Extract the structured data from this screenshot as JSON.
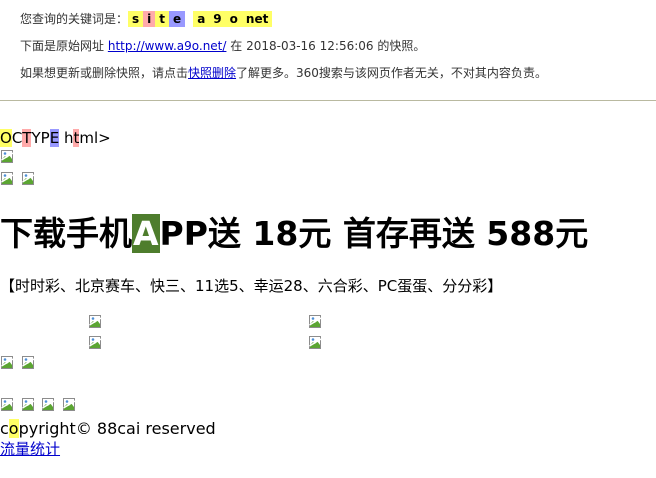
{
  "header": {
    "query_prefix": "您查询的关键词是：",
    "keywords": [
      {
        "text": "s",
        "color": "#ffff66"
      },
      {
        "text": "i",
        "color": "#ffaaaa"
      },
      {
        "text": "t",
        "color": "#ffff66"
      },
      {
        "text": "e",
        "color": "#9999ff"
      },
      {
        "text": "a",
        "color": "#ffff66"
      },
      {
        "text": "9",
        "color": "#ffff66"
      },
      {
        "text": "o",
        "color": "#ffff66"
      },
      {
        "text": "net",
        "color": "#ffff66"
      }
    ],
    "original_prefix": "下面是原始网址",
    "original_url": "http://www.a9o.net/",
    "snapshot_date_text": "在 2018-03-16 12:56:06 的快照。",
    "notice_prefix": "如果想更新或删除快照，请点击",
    "notice_link": "快照删除",
    "notice_suffix": "了解更多。360搜索与该网页作者无关，不对其内容负责。"
  },
  "page": {
    "doctype_parts": [
      {
        "text": "O",
        "color": "#ffff66"
      },
      {
        "text": "C",
        "color": ""
      },
      {
        "text": "T",
        "color": "#ffaaaa"
      },
      {
        "text": "Y",
        "color": ""
      },
      {
        "text": "P",
        "color": ""
      },
      {
        "text": "E",
        "color": "#9999ff"
      },
      {
        "text": " h",
        "color": ""
      },
      {
        "text": "t",
        "color": "#ffaaaa"
      },
      {
        "text": "ml>",
        "color": ""
      }
    ],
    "title_before": "下载手机",
    "title_highlight": "A",
    "title_highlight_color": "#4e7d2d",
    "title_after": "PP送 18元 首存再送 588元",
    "games_line": "【时时彩、北京赛车、快三、11选5、幸运28、六合彩、PC蛋蛋、分分彩】",
    "copyright_first": "c",
    "copyright_highlight": "o",
    "copyright_highlight_color": "#ffff66",
    "copyright_rest": "pyright© 88cai reserved",
    "stats_link": "流量统计"
  }
}
